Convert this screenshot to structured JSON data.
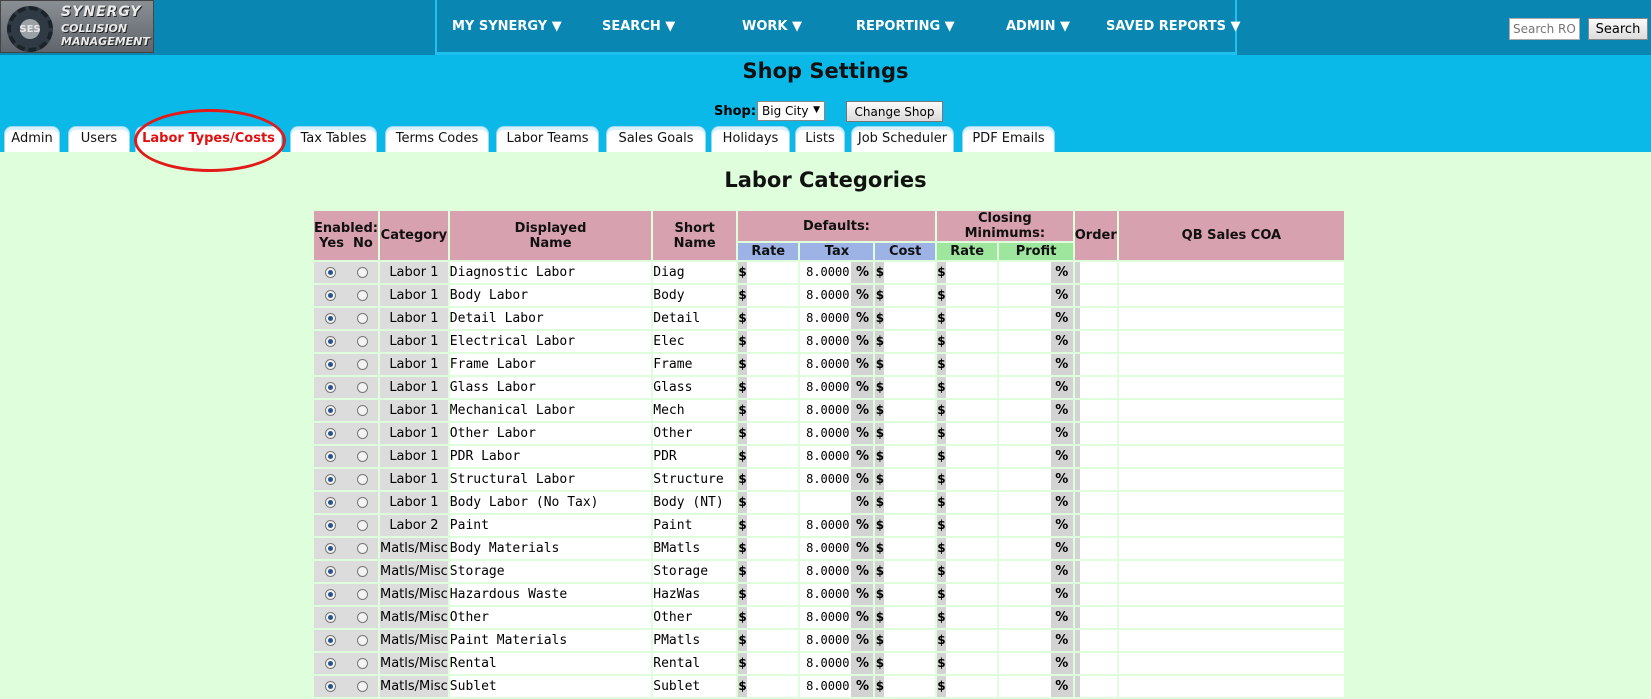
{
  "logo": {
    "badge": "SES",
    "line1": "SYNERGY",
    "line2": "COLLISION",
    "line3": "MANAGEMENT"
  },
  "nav": {
    "items": [
      {
        "label": "MY SYNERGY ▼"
      },
      {
        "label": "SEARCH ▼"
      },
      {
        "label": "WORK ▼"
      },
      {
        "label": "REPORTING ▼"
      },
      {
        "label": "ADMIN ▼"
      },
      {
        "label": "SAVED REPORTS ▼"
      }
    ]
  },
  "search": {
    "placeholder": "Search RO",
    "button_label": "Search"
  },
  "page": {
    "title": "Shop Settings",
    "shop_label": "Shop:",
    "shop_value": "Big City",
    "change_shop_label": "Change Shop"
  },
  "tabs": [
    {
      "label": "Admin"
    },
    {
      "label": "Users"
    },
    {
      "label": "Labor Types/Costs",
      "active": true
    },
    {
      "label": "Tax Tables"
    },
    {
      "label": "Terms Codes"
    },
    {
      "label": "Labor Teams"
    },
    {
      "label": "Sales Goals"
    },
    {
      "label": "Holidays"
    },
    {
      "label": "Lists"
    },
    {
      "label": "Job Scheduler"
    },
    {
      "label": "PDF Emails"
    }
  ],
  "section_title": "Labor Categories",
  "table": {
    "headers": {
      "enabled": "Enabled:",
      "yes": "Yes",
      "no": "No",
      "category": "Category",
      "displayed_name_1": "Displayed",
      "displayed_name_2": "Name",
      "short_name_1": "Short",
      "short_name_2": "Name",
      "defaults": "Defaults:",
      "closing_minimums": "Closing Minimums:",
      "order": "Order",
      "qb_sales_coa": "QB Sales COA",
      "rate": "Rate",
      "tax": "Tax",
      "cost": "Cost",
      "closing_rate": "Rate",
      "profit": "Profit"
    },
    "currency_symbol": "$",
    "percent_symbol": "%",
    "rows": [
      {
        "category": "Labor 1",
        "displayed": "Diagnostic Labor",
        "short": "Diag",
        "tax": "8.0000"
      },
      {
        "category": "Labor 1",
        "displayed": "Body Labor",
        "short": "Body",
        "tax": "8.0000"
      },
      {
        "category": "Labor 1",
        "displayed": "Detail Labor",
        "short": "Detail",
        "tax": "8.0000"
      },
      {
        "category": "Labor 1",
        "displayed": "Electrical Labor",
        "short": "Elec",
        "tax": "8.0000"
      },
      {
        "category": "Labor 1",
        "displayed": "Frame Labor",
        "short": "Frame",
        "tax": "8.0000"
      },
      {
        "category": "Labor 1",
        "displayed": "Glass Labor",
        "short": "Glass",
        "tax": "8.0000"
      },
      {
        "category": "Labor 1",
        "displayed": "Mechanical Labor",
        "short": "Mech",
        "tax": "8.0000"
      },
      {
        "category": "Labor 1",
        "displayed": "Other Labor",
        "short": "Other",
        "tax": "8.0000"
      },
      {
        "category": "Labor 1",
        "displayed": "PDR Labor",
        "short": "PDR",
        "tax": "8.0000"
      },
      {
        "category": "Labor 1",
        "displayed": "Structural Labor",
        "short": "Structure",
        "tax": "8.0000"
      },
      {
        "category": "Labor 1",
        "displayed": "Body Labor (No Tax)",
        "short": "Body (NT)",
        "tax": ""
      },
      {
        "category": "Labor 2",
        "displayed": "Paint",
        "short": "Paint",
        "tax": "8.0000"
      },
      {
        "category": "Matls/Misc",
        "displayed": "Body Materials",
        "short": "BMatls",
        "tax": "8.0000"
      },
      {
        "category": "Matls/Misc",
        "displayed": "Storage",
        "short": "Storage",
        "tax": "8.0000"
      },
      {
        "category": "Matls/Misc",
        "displayed": "Hazardous Waste",
        "short": "HazWas",
        "tax": "8.0000"
      },
      {
        "category": "Matls/Misc",
        "displayed": "Other",
        "short": "Other",
        "tax": "8.0000"
      },
      {
        "category": "Matls/Misc",
        "displayed": "Paint Materials",
        "short": "PMatls",
        "tax": "8.0000"
      },
      {
        "category": "Matls/Misc",
        "displayed": "Rental",
        "short": "Rental",
        "tax": "8.0000"
      },
      {
        "category": "Matls/Misc",
        "displayed": "Sublet",
        "short": "Sublet",
        "tax": "8.0000"
      }
    ]
  }
}
